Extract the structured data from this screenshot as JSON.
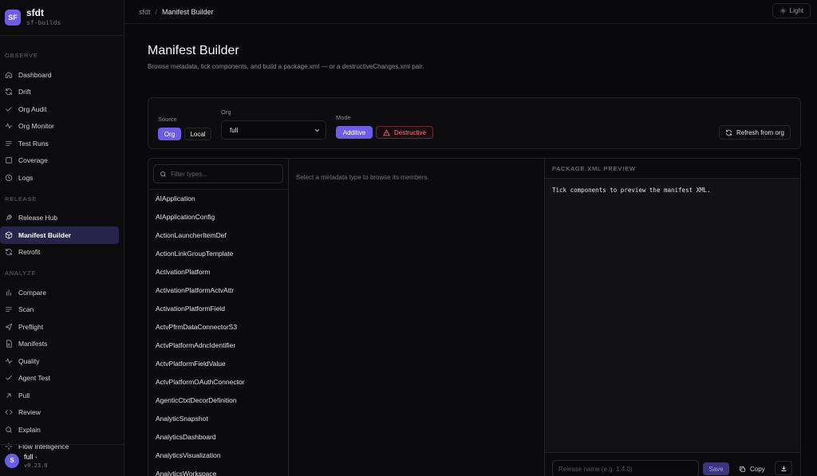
{
  "brand": {
    "logo": "SF",
    "title": "sfdt",
    "subtitle": "sf-builds"
  },
  "sidebar": {
    "sections": [
      {
        "label": "OBSERVE",
        "items": [
          {
            "label": "Dashboard",
            "icon": "home-icon"
          },
          {
            "label": "Drift",
            "icon": "refresh-icon"
          },
          {
            "label": "Org Audit",
            "icon": "check-icon"
          },
          {
            "label": "Org Monitor",
            "icon": "pulse-icon"
          },
          {
            "label": "Test Runs",
            "icon": "list-icon"
          },
          {
            "label": "Coverage",
            "icon": "box-icon"
          },
          {
            "label": "Logs",
            "icon": "clock-icon"
          }
        ]
      },
      {
        "label": "RELEASE",
        "items": [
          {
            "label": "Release Hub",
            "icon": "rocket-icon"
          },
          {
            "label": "Manifest Builder",
            "icon": "package-icon",
            "active": true
          },
          {
            "label": "Retrofit",
            "icon": "refresh-icon"
          }
        ]
      },
      {
        "label": "ANALYZE",
        "items": [
          {
            "label": "Compare",
            "icon": "bars-icon"
          },
          {
            "label": "Scan",
            "icon": "list-icon"
          },
          {
            "label": "Preflight",
            "icon": "send-icon"
          },
          {
            "label": "Manifests",
            "icon": "file-icon"
          },
          {
            "label": "Quality",
            "icon": "pulse-icon"
          },
          {
            "label": "Agent Test",
            "icon": "check-icon"
          },
          {
            "label": "Pull",
            "icon": "arrow-icon"
          },
          {
            "label": "Review",
            "icon": "code-icon"
          },
          {
            "label": "Explain",
            "icon": "search-icon"
          },
          {
            "label": "Flow Intelligence",
            "icon": "sparkle-icon"
          }
        ]
      }
    ],
    "footer": {
      "avatar": "S",
      "name": "full ·",
      "version": "v0.23.0"
    }
  },
  "topbar": {
    "crumb_root": "sfdt",
    "crumb_sep": "/",
    "crumb_current": "Manifest Builder",
    "theme_label": "Light"
  },
  "page": {
    "title": "Manifest Builder",
    "subtitle": "Browse metadata, tick components, and build a package.xml — or a destructiveChanges.xml pair."
  },
  "controls": {
    "source_label": "Source",
    "source_options": [
      "Org",
      "Local"
    ],
    "org_label": "Org",
    "org_value": "full",
    "mode_label": "Mode",
    "mode_options": [
      "Additive",
      "Destructive"
    ],
    "refresh_label": "Refresh from org"
  },
  "types": {
    "filter_placeholder": "Filter types...",
    "items": [
      "AIApplication",
      "AIApplicationConfig",
      "ActionLauncherItemDef",
      "ActionLinkGroupTemplate",
      "ActivationPlatform",
      "ActivationPlatformActvAttr",
      "ActivationPlatformField",
      "ActvPfrmDataConnectorS3",
      "ActvPlatformAdncIdentifier",
      "ActvPlatformFieldValue",
      "ActvPlatformOAuthConnector",
      "AgenticCtxtDecorDefinition",
      "AnalyticSnapshot",
      "AnalyticsDashboard",
      "AnalyticsVisualization",
      "AnalyticsWorkspace"
    ]
  },
  "members": {
    "empty_text": "Select a metadata type to browse its members."
  },
  "preview": {
    "header": "PACKAGE.XML PREVIEW",
    "body": "Tick components to preview the manifest XML.",
    "release_placeholder": "Release name (e.g. 1.4.0)",
    "save_label": "Save",
    "copy_label": "Copy"
  },
  "colors": {
    "accent": "#6d5ce8",
    "destructive": "#f47b86",
    "background": "#09090b"
  }
}
